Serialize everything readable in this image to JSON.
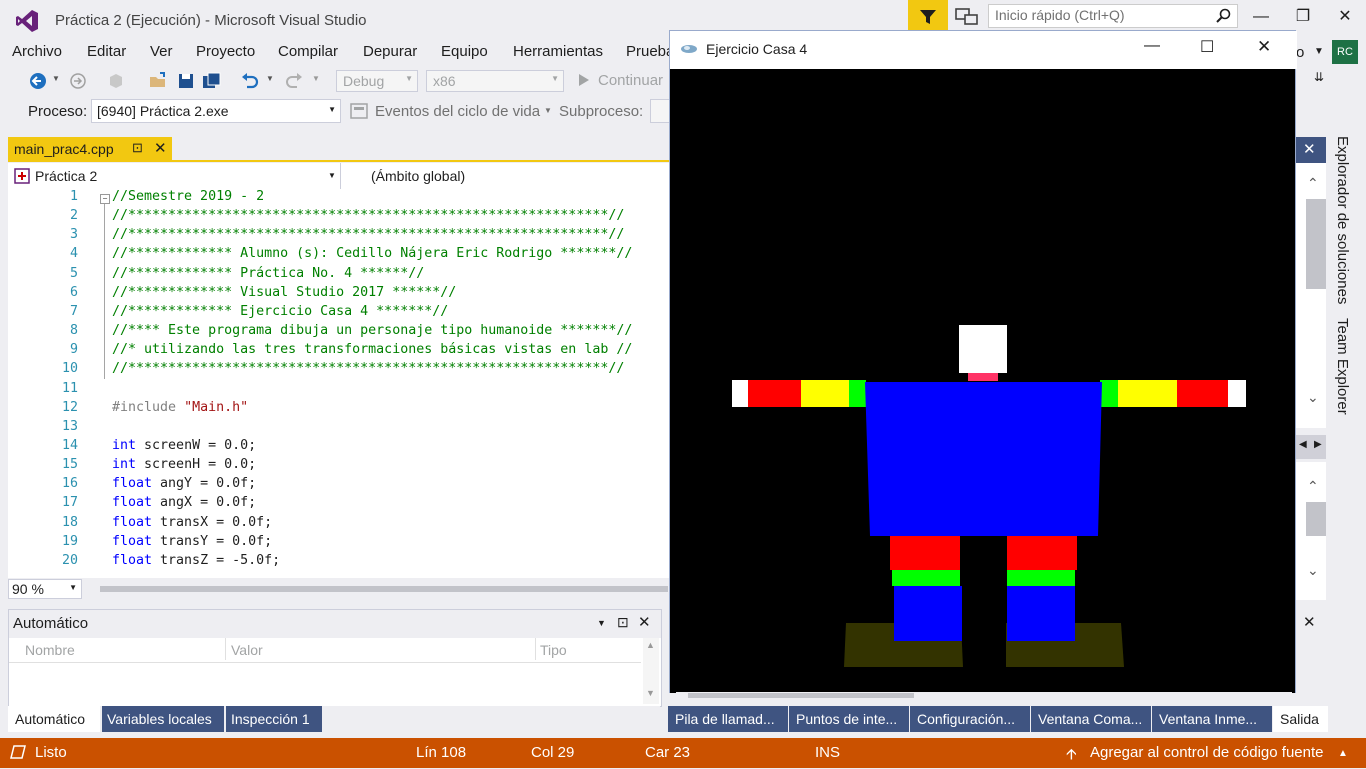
{
  "vs": {
    "title": "Práctica 2 (Ejecución) - Microsoft Visual Studio",
    "quick_launch_placeholder": "Inicio rápido (Ctrl+Q)",
    "user_initials": "RC",
    "menu": [
      "Archivo",
      "Editar",
      "Ver",
      "Proyecto",
      "Compilar",
      "Depurar",
      "Equipo",
      "Herramientas",
      "Prueba"
    ],
    "toolbar": {
      "config": "Debug",
      "platform": "x86",
      "continue_label": "Continuar"
    },
    "process_bar": {
      "process_label": "Proceso:",
      "process_value": "[6940] Práctica 2.exe",
      "lifecycle_label": "Eventos del ciclo de vida",
      "thread_label": "Subproceso:"
    }
  },
  "editor": {
    "tab_label": "main_prac4.cpp",
    "project_combo": "Práctica 2",
    "scope_combo": "(Ámbito global)",
    "zoom": "90 %",
    "lines": [
      {
        "n": "1",
        "t": "//Semestre 2019 - 2",
        "c": "cm"
      },
      {
        "n": "2",
        "t": "//************************************************************//",
        "c": "cm"
      },
      {
        "n": "3",
        "t": "//************************************************************//",
        "c": "cm"
      },
      {
        "n": "4",
        "t": "//************* Alumno (s): Cedillo Nájera Eric Rodrigo *******//",
        "c": "cm"
      },
      {
        "n": "5",
        "t": "//************* Práctica No. 4 ******//",
        "c": "cm"
      },
      {
        "n": "6",
        "t": "//************* Visual Studio 2017 ******//",
        "c": "cm"
      },
      {
        "n": "7",
        "t": "//************* Ejercicio Casa 4 *******//",
        "c": "cm"
      },
      {
        "n": "8",
        "t": "//**** Este programa dibuja un personaje tipo humanoide *******//",
        "c": "cm"
      },
      {
        "n": "9",
        "t": "//* utilizando las tres transformaciones básicas vistas en lab //",
        "c": "cm"
      },
      {
        "n": "10",
        "t": "//************************************************************//",
        "c": "cm"
      },
      {
        "n": "11",
        "t": "",
        "c": ""
      },
      {
        "n": "12",
        "t": "#include \"Main.h\"",
        "c": "inc"
      },
      {
        "n": "13",
        "t": "",
        "c": ""
      },
      {
        "n": "14",
        "t": "int screenW = 0.0;",
        "c": "decl",
        "kw": "int"
      },
      {
        "n": "15",
        "t": "int screenH = 0.0;",
        "c": "decl",
        "kw": "int"
      },
      {
        "n": "16",
        "t": "float angY = 0.0f;",
        "c": "decl",
        "kw": "float"
      },
      {
        "n": "17",
        "t": "float angX = 0.0f;",
        "c": "decl",
        "kw": "float"
      },
      {
        "n": "18",
        "t": "float transX = 0.0f;",
        "c": "decl",
        "kw": "float"
      },
      {
        "n": "19",
        "t": "float transY = 0.0f;",
        "c": "decl",
        "kw": "float"
      },
      {
        "n": "20",
        "t": "float transZ = -5.0f;",
        "c": "decl",
        "kw": "float"
      }
    ]
  },
  "auto_panel": {
    "title": "Automático",
    "columns": [
      "Nombre",
      "Valor",
      "Tipo"
    ]
  },
  "bottom_tabs_left": [
    "Automático",
    "Variables locales",
    "Inspección 1"
  ],
  "bottom_tabs_right": [
    "Pila de llamad...",
    "Puntos de inte...",
    "Configuración...",
    "Ventana Coma...",
    "Ventana Inme...",
    "Salida"
  ],
  "side_tabs": [
    "Explorador de soluciones",
    "Team Explorer"
  ],
  "status": {
    "ready": "Listo",
    "line": "Lín 108",
    "col": "Col 29",
    "char": "Car 23",
    "mode": "INS",
    "source_control": "Agregar al control de código fuente"
  },
  "gl_window": {
    "title": "Ejercicio Casa 4"
  },
  "colors": {
    "accent_yellow": "#F2C811",
    "status_orange": "#CA5100",
    "body_blue": "#0000FF",
    "red": "#FF0000",
    "yellow": "#FFFF00",
    "green": "#00FF00",
    "white": "#FFFFFF",
    "neck_pink": "#FF3366",
    "feet_olive": "#333300"
  }
}
